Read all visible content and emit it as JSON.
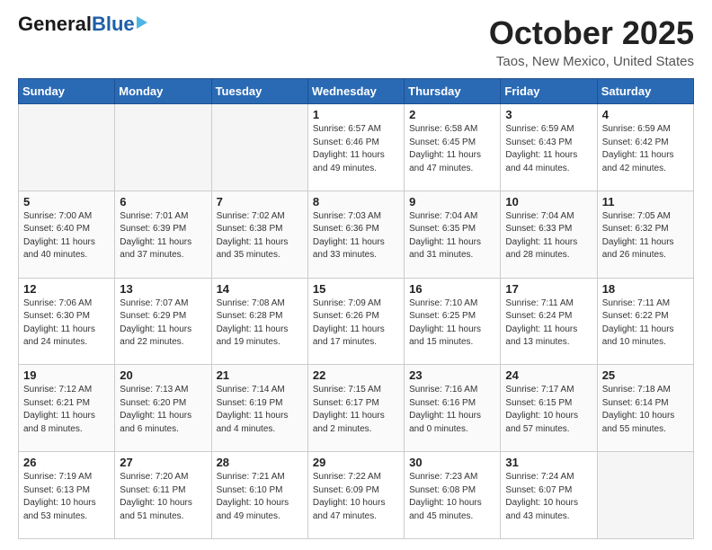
{
  "header": {
    "logo_general": "General",
    "logo_blue": "Blue",
    "title": "October 2025",
    "subtitle": "Taos, New Mexico, United States"
  },
  "days_of_week": [
    "Sunday",
    "Monday",
    "Tuesday",
    "Wednesday",
    "Thursday",
    "Friday",
    "Saturday"
  ],
  "weeks": [
    [
      {
        "day": "",
        "info": ""
      },
      {
        "day": "",
        "info": ""
      },
      {
        "day": "",
        "info": ""
      },
      {
        "day": "1",
        "info": "Sunrise: 6:57 AM\nSunset: 6:46 PM\nDaylight: 11 hours and 49 minutes."
      },
      {
        "day": "2",
        "info": "Sunrise: 6:58 AM\nSunset: 6:45 PM\nDaylight: 11 hours and 47 minutes."
      },
      {
        "day": "3",
        "info": "Sunrise: 6:59 AM\nSunset: 6:43 PM\nDaylight: 11 hours and 44 minutes."
      },
      {
        "day": "4",
        "info": "Sunrise: 6:59 AM\nSunset: 6:42 PM\nDaylight: 11 hours and 42 minutes."
      }
    ],
    [
      {
        "day": "5",
        "info": "Sunrise: 7:00 AM\nSunset: 6:40 PM\nDaylight: 11 hours and 40 minutes."
      },
      {
        "day": "6",
        "info": "Sunrise: 7:01 AM\nSunset: 6:39 PM\nDaylight: 11 hours and 37 minutes."
      },
      {
        "day": "7",
        "info": "Sunrise: 7:02 AM\nSunset: 6:38 PM\nDaylight: 11 hours and 35 minutes."
      },
      {
        "day": "8",
        "info": "Sunrise: 7:03 AM\nSunset: 6:36 PM\nDaylight: 11 hours and 33 minutes."
      },
      {
        "day": "9",
        "info": "Sunrise: 7:04 AM\nSunset: 6:35 PM\nDaylight: 11 hours and 31 minutes."
      },
      {
        "day": "10",
        "info": "Sunrise: 7:04 AM\nSunset: 6:33 PM\nDaylight: 11 hours and 28 minutes."
      },
      {
        "day": "11",
        "info": "Sunrise: 7:05 AM\nSunset: 6:32 PM\nDaylight: 11 hours and 26 minutes."
      }
    ],
    [
      {
        "day": "12",
        "info": "Sunrise: 7:06 AM\nSunset: 6:30 PM\nDaylight: 11 hours and 24 minutes."
      },
      {
        "day": "13",
        "info": "Sunrise: 7:07 AM\nSunset: 6:29 PM\nDaylight: 11 hours and 22 minutes."
      },
      {
        "day": "14",
        "info": "Sunrise: 7:08 AM\nSunset: 6:28 PM\nDaylight: 11 hours and 19 minutes."
      },
      {
        "day": "15",
        "info": "Sunrise: 7:09 AM\nSunset: 6:26 PM\nDaylight: 11 hours and 17 minutes."
      },
      {
        "day": "16",
        "info": "Sunrise: 7:10 AM\nSunset: 6:25 PM\nDaylight: 11 hours and 15 minutes."
      },
      {
        "day": "17",
        "info": "Sunrise: 7:11 AM\nSunset: 6:24 PM\nDaylight: 11 hours and 13 minutes."
      },
      {
        "day": "18",
        "info": "Sunrise: 7:11 AM\nSunset: 6:22 PM\nDaylight: 11 hours and 10 minutes."
      }
    ],
    [
      {
        "day": "19",
        "info": "Sunrise: 7:12 AM\nSunset: 6:21 PM\nDaylight: 11 hours and 8 minutes."
      },
      {
        "day": "20",
        "info": "Sunrise: 7:13 AM\nSunset: 6:20 PM\nDaylight: 11 hours and 6 minutes."
      },
      {
        "day": "21",
        "info": "Sunrise: 7:14 AM\nSunset: 6:19 PM\nDaylight: 11 hours and 4 minutes."
      },
      {
        "day": "22",
        "info": "Sunrise: 7:15 AM\nSunset: 6:17 PM\nDaylight: 11 hours and 2 minutes."
      },
      {
        "day": "23",
        "info": "Sunrise: 7:16 AM\nSunset: 6:16 PM\nDaylight: 11 hours and 0 minutes."
      },
      {
        "day": "24",
        "info": "Sunrise: 7:17 AM\nSunset: 6:15 PM\nDaylight: 10 hours and 57 minutes."
      },
      {
        "day": "25",
        "info": "Sunrise: 7:18 AM\nSunset: 6:14 PM\nDaylight: 10 hours and 55 minutes."
      }
    ],
    [
      {
        "day": "26",
        "info": "Sunrise: 7:19 AM\nSunset: 6:13 PM\nDaylight: 10 hours and 53 minutes."
      },
      {
        "day": "27",
        "info": "Sunrise: 7:20 AM\nSunset: 6:11 PM\nDaylight: 10 hours and 51 minutes."
      },
      {
        "day": "28",
        "info": "Sunrise: 7:21 AM\nSunset: 6:10 PM\nDaylight: 10 hours and 49 minutes."
      },
      {
        "day": "29",
        "info": "Sunrise: 7:22 AM\nSunset: 6:09 PM\nDaylight: 10 hours and 47 minutes."
      },
      {
        "day": "30",
        "info": "Sunrise: 7:23 AM\nSunset: 6:08 PM\nDaylight: 10 hours and 45 minutes."
      },
      {
        "day": "31",
        "info": "Sunrise: 7:24 AM\nSunset: 6:07 PM\nDaylight: 10 hours and 43 minutes."
      },
      {
        "day": "",
        "info": ""
      }
    ]
  ]
}
